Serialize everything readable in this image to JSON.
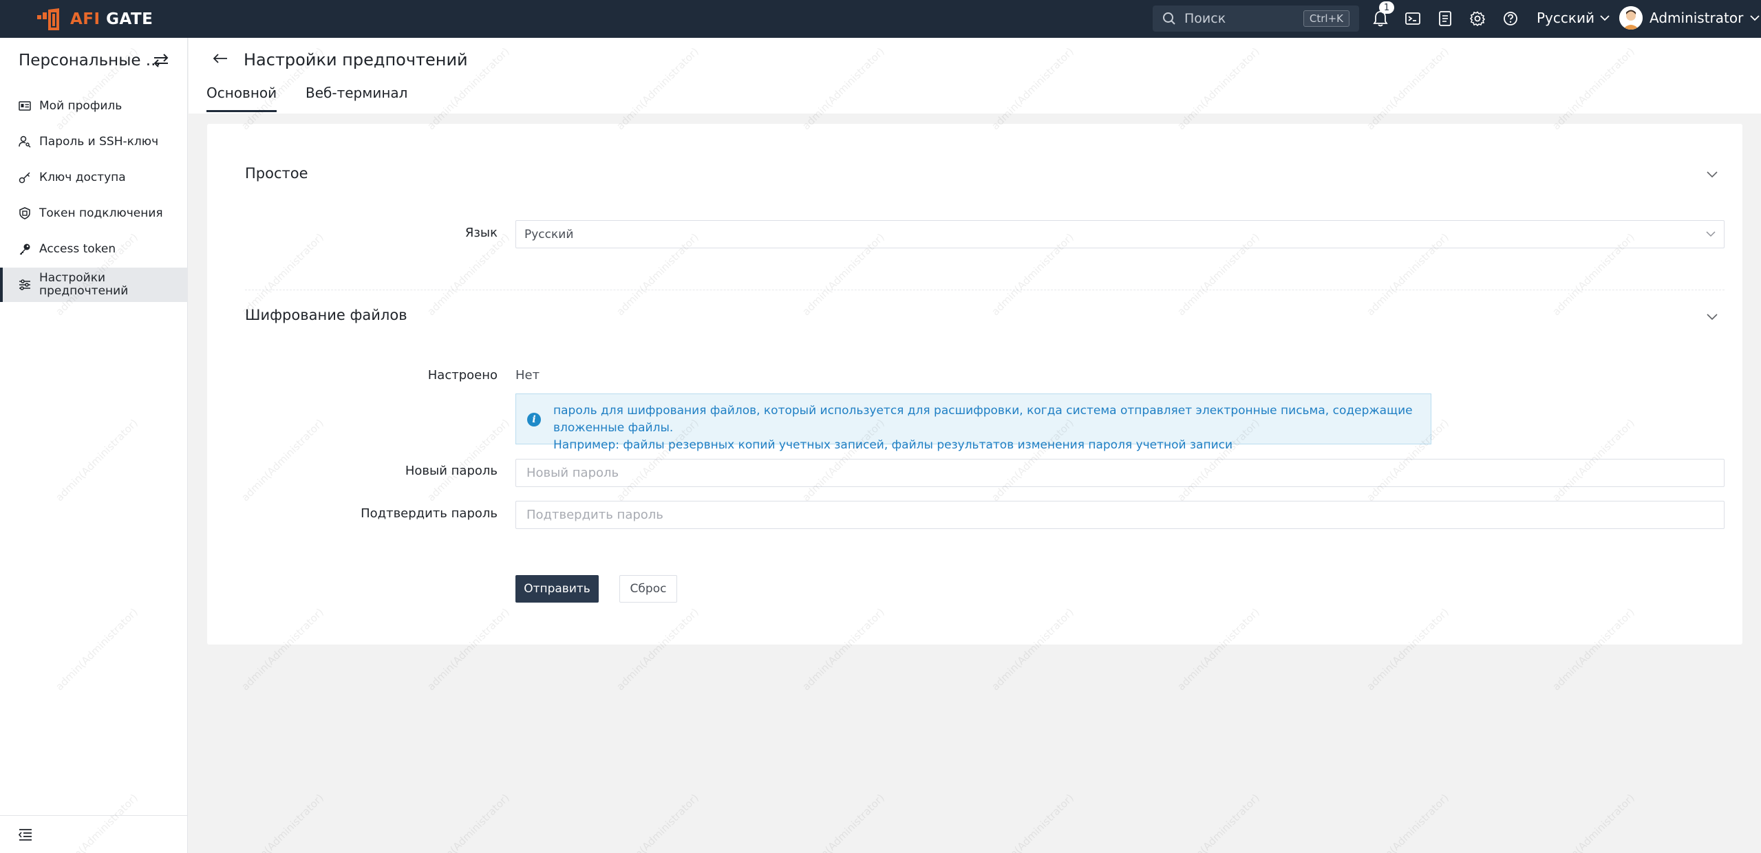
{
  "brand": {
    "name_prefix": "AFI",
    "name_suffix": "GATE"
  },
  "topbar": {
    "search_label": "Поиск",
    "search_shortcut": "Ctrl+K",
    "notification_count": "1",
    "language": "Русский",
    "user_name": "Administrator"
  },
  "sidebar": {
    "title": "Персональные ...",
    "items": [
      {
        "label": "Мой профиль",
        "icon": "id-card-icon"
      },
      {
        "label": "Пароль и SSH-ключ",
        "icon": "user-key-icon"
      },
      {
        "label": "Ключ доступа",
        "icon": "key-icon"
      },
      {
        "label": "Токен подключения",
        "icon": "shield-token-icon"
      },
      {
        "label": "Access token",
        "icon": "key-solid-icon"
      },
      {
        "label": "Настройки предпочтений",
        "icon": "sliders-icon"
      }
    ]
  },
  "page": {
    "title": "Настройки предпочтений",
    "tabs": [
      "Основной",
      "Веб-терминал"
    ]
  },
  "form": {
    "section_basic": "Простое",
    "language_label": "Язык",
    "language_value": "Русский",
    "section_encryption": "Шифрование файлов",
    "configured_label": "Настроено",
    "configured_value": "Нет",
    "info_line1": "пароль для шифрования файлов, который используется для расшифровки, когда система отправляет электронные письма, содержащие вложенные файлы.",
    "info_line2": "Например: файлы резервных копий учетных записей, файлы результатов изменения пароля учетной записи",
    "new_password_label": "Новый пароль",
    "new_password_placeholder": "Новый пароль",
    "confirm_password_label": "Подтвердить пароль",
    "confirm_password_placeholder": "Подтвердить пароль",
    "submit_label": "Отправить",
    "reset_label": "Сброс"
  },
  "watermark": "admin(Administrator)",
  "colors": {
    "topbar": "#1f2b3a",
    "brand_accent": "#e8692b",
    "primary_button": "#2b3a4e",
    "info_text": "#1f7fc4"
  }
}
